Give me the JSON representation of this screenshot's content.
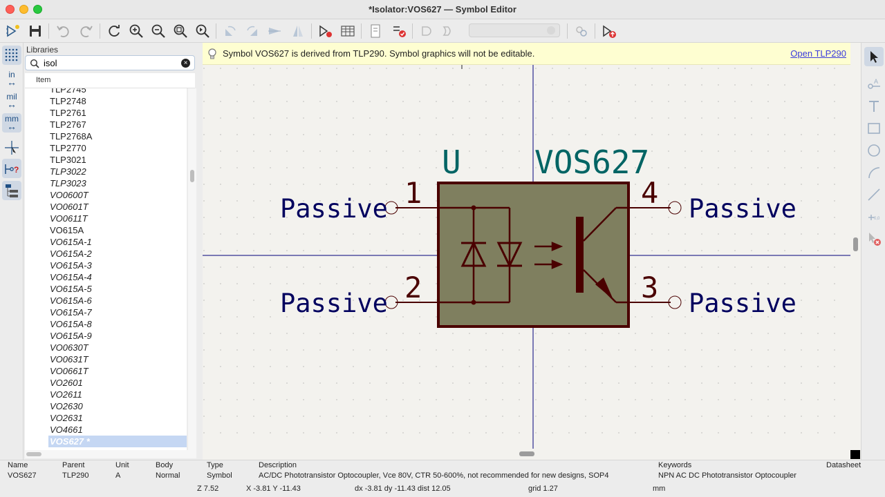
{
  "window": {
    "title": "*Isolator:VOS627 — Symbol Editor"
  },
  "toolbar": {
    "icons": [
      "new-symbol-icon",
      "save-icon",
      "undo-icon",
      "redo-icon",
      "refresh-icon",
      "zoom-in-icon",
      "zoom-out-icon",
      "zoom-fit-icon",
      "zoom-selection-icon",
      "rotate-ccw-icon",
      "rotate-cw-icon",
      "mirror-h-icon",
      "mirror-v-icon",
      "symbol-properties-icon",
      "pin-table-icon",
      "datasheet-icon",
      "symbol-checker-icon",
      "de-morgan-standard-icon",
      "de-morgan-alternate-icon",
      "unit-selector",
      "sync-pins-icon",
      "add-to-schematic-icon"
    ],
    "unit_select_value": ""
  },
  "left_toolbar": {
    "grid_label": "grid",
    "inch_label": "in",
    "mil_label": "mil",
    "mm_label": "mm"
  },
  "libraries": {
    "title": "Libraries",
    "search_value": "isol",
    "column_header": "Item",
    "items": [
      {
        "name": "TLP2745",
        "italic": false
      },
      {
        "name": "TLP2748",
        "italic": false
      },
      {
        "name": "TLP2761",
        "italic": false
      },
      {
        "name": "TLP2767",
        "italic": false
      },
      {
        "name": "TLP2768A",
        "italic": false
      },
      {
        "name": "TLP2770",
        "italic": false
      },
      {
        "name": "TLP3021",
        "italic": false
      },
      {
        "name": "TLP3022",
        "italic": true
      },
      {
        "name": "TLP3023",
        "italic": true
      },
      {
        "name": "VO0600T",
        "italic": true
      },
      {
        "name": "VO0601T",
        "italic": true
      },
      {
        "name": "VO0611T",
        "italic": true
      },
      {
        "name": "VO615A",
        "italic": false
      },
      {
        "name": "VO615A-1",
        "italic": true
      },
      {
        "name": "VO615A-2",
        "italic": true
      },
      {
        "name": "VO615A-3",
        "italic": true
      },
      {
        "name": "VO615A-4",
        "italic": true
      },
      {
        "name": "VO615A-5",
        "italic": true
      },
      {
        "name": "VO615A-6",
        "italic": true
      },
      {
        "name": "VO615A-7",
        "italic": true
      },
      {
        "name": "VO615A-8",
        "italic": true
      },
      {
        "name": "VO615A-9",
        "italic": true
      },
      {
        "name": "VO0630T",
        "italic": true
      },
      {
        "name": "VO0631T",
        "italic": true
      },
      {
        "name": "VO0661T",
        "italic": true
      },
      {
        "name": "VO2601",
        "italic": true
      },
      {
        "name": "VO2611",
        "italic": true
      },
      {
        "name": "VO2630",
        "italic": true
      },
      {
        "name": "VO2631",
        "italic": true
      },
      {
        "name": "VO4661",
        "italic": true
      }
    ],
    "selected_item": "VOS627 *"
  },
  "infobar": {
    "message": "Symbol VOS627 is derived from TLP290.  Symbol graphics will not be editable.",
    "link": "Open TLP290"
  },
  "symbol": {
    "reference": "U",
    "value": "VOS627",
    "pins": [
      {
        "number": "1",
        "type": "Passive",
        "side": "left"
      },
      {
        "number": "2",
        "type": "Passive",
        "side": "left"
      },
      {
        "number": "4",
        "type": "Passive",
        "side": "right"
      },
      {
        "number": "3",
        "type": "Passive",
        "side": "right"
      }
    ],
    "colors": {
      "body_fill": "#7f7f5f",
      "body_stroke": "#4a0000",
      "field": "#006464",
      "pin_name": "#00005e",
      "axis": "#00007a"
    }
  },
  "properties": {
    "headers": [
      "Name",
      "Parent",
      "Unit",
      "Body",
      "Type",
      "Description",
      "Keywords",
      "Datasheet"
    ],
    "values": [
      "VOS627",
      "TLP290",
      "A",
      "Normal",
      "Symbol",
      "AC/DC Phototransistor Optocoupler, Vce 80V, CTR 50-600%, not recommended for new designs, SOP4",
      "NPN AC DC Phototransistor Optocoupler",
      ""
    ]
  },
  "status": {
    "zoom": "Z 7.52",
    "coords": "X -3.81  Y -11.43",
    "delta": "dx -3.81  dy -11.43  dist 12.05",
    "grid": "grid 1.27",
    "units": "mm"
  }
}
